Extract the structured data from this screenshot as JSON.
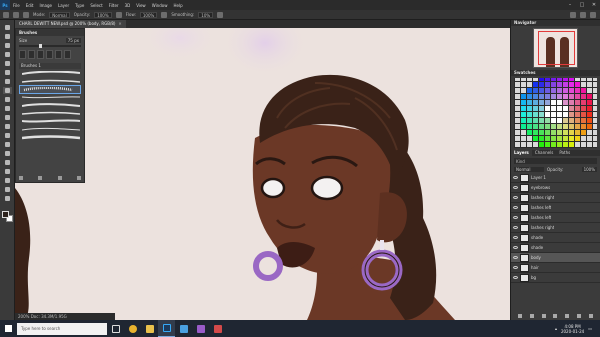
{
  "app": {
    "menus": [
      "File",
      "Edit",
      "Image",
      "Layer",
      "Type",
      "Select",
      "Filter",
      "3D",
      "View",
      "Window",
      "Help"
    ],
    "window_controls": [
      "–",
      "□",
      "✕"
    ]
  },
  "options_bar": {
    "mode_label": "Mode:",
    "mode_value": "Normal",
    "opacity_label": "Opacity:",
    "opacity_value": "100%",
    "flow_label": "Flow:",
    "flow_value": "100%",
    "smoothing_label": "Smoothing:",
    "smoothing_value": "10%"
  },
  "document": {
    "tab_title": "CHARL DEWITT NEW.psd @ 200% (body, RGB/8)",
    "close_glyph": "✕"
  },
  "brushes_panel": {
    "title": "Brushes",
    "size_label": "Size",
    "size_value": "75 px",
    "group_label": "Brushes 1"
  },
  "status_bar": {
    "zoom": "200%",
    "doc_info": "Doc: 34.3M/1.95G"
  },
  "right_panel": {
    "navigator_title": "Navigator",
    "swatches_title": "Swatches",
    "layers_tabs": [
      "Layers",
      "Channels",
      "Paths"
    ],
    "layers_filter_label": "Kind",
    "blend_mode": "Normal",
    "opacity_label": "Opacity:",
    "opacity_value": "100%",
    "layers": [
      {
        "name": "Layer 1"
      },
      {
        "name": "eyebrows"
      },
      {
        "name": "lashes right"
      },
      {
        "name": "lashes left"
      },
      {
        "name": "lashes left"
      },
      {
        "name": "lashes right"
      },
      {
        "name": "shade"
      },
      {
        "name": "shade"
      },
      {
        "name": "body"
      },
      {
        "name": "hair"
      },
      {
        "name": "bg"
      }
    ],
    "active_layer": "body"
  },
  "taskbar": {
    "search_placeholder": "Type here to search",
    "time": "4:08 PM",
    "date": "2020-01-24"
  },
  "colors": {
    "canvas_bg": "#ece2de",
    "skin": "#6b3826",
    "hair": "#3a2218",
    "earring": "#9a68c4",
    "accent_selection": "#6aa6e8"
  }
}
